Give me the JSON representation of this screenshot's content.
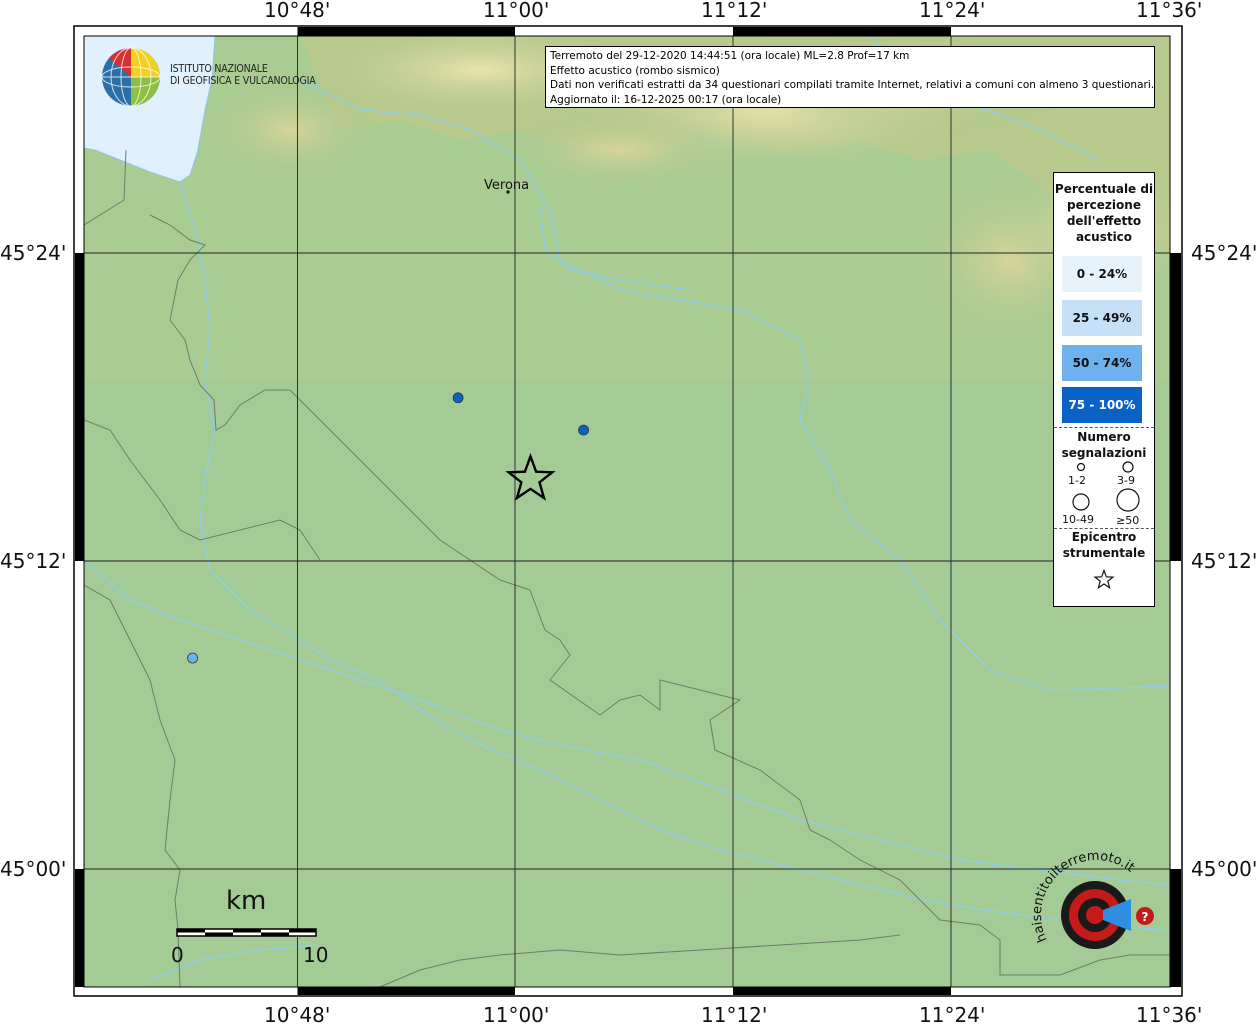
{
  "header": {
    "line1": "Terremoto del 29-12-2020 14:44:51 (ora locale) ML=2.8 Prof=17 km",
    "line2": "Effetto acustico (rombo sismico)",
    "line3": "Dati non verificati estratti da 34 questionari compilati tramite Internet, relativi a comuni con almeno 3 questionari.",
    "line4": "Aggiornato il: 16-12-2025 00:17 (ora locale)"
  },
  "logo": {
    "line1": "ISTITUTO NAZIONALE",
    "line2": "DI GEOFISICA E VULCANOLOGIA"
  },
  "city": "Verona",
  "axes": {
    "top": [
      "10°48'",
      "11°00'",
      "11°12'",
      "11°24'",
      "11°36'"
    ],
    "bottom": [
      "10°48'",
      "11°00'",
      "11°12'",
      "11°24'",
      "11°36'"
    ],
    "left": [
      "45°24'",
      "45°12'",
      "45°00'"
    ],
    "right": [
      "45°24'",
      "45°12'",
      "45°00'"
    ]
  },
  "legend": {
    "title": "Percentuale di percezione dell'effetto acustico",
    "classes": [
      {
        "label": "0 - 24%",
        "color": "#e6f2fc",
        "text": "#111111"
      },
      {
        "label": "25 - 49%",
        "color": "#c6e0f8",
        "text": "#111111"
      },
      {
        "label": "50 - 74%",
        "color": "#6db1ee",
        "text": "#111111"
      },
      {
        "label": "75 - 100%",
        "color": "#0a63c4",
        "text": "#ffffff"
      }
    ],
    "count_title": "Numero segnalazioni",
    "sizes": [
      "1-2",
      "3-9",
      "10-49",
      "≥50"
    ],
    "epicenter_title": "Epicentro strumentale"
  },
  "points": [
    {
      "lon": 11.01,
      "lat": 45.306,
      "color": "#0a63c4"
    },
    {
      "lon": 11.114,
      "lat": 45.285,
      "color": "#0a63c4"
    },
    {
      "lon": 10.79,
      "lat": 45.137,
      "color": "#6db1ee"
    }
  ],
  "epicenter": {
    "lon": 11.07,
    "lat": 45.253
  },
  "scale": {
    "unit": "km",
    "min": "0",
    "max": "10"
  },
  "brand": {
    "text": "haisentitoilterremoto.it",
    "sub": "www"
  }
}
